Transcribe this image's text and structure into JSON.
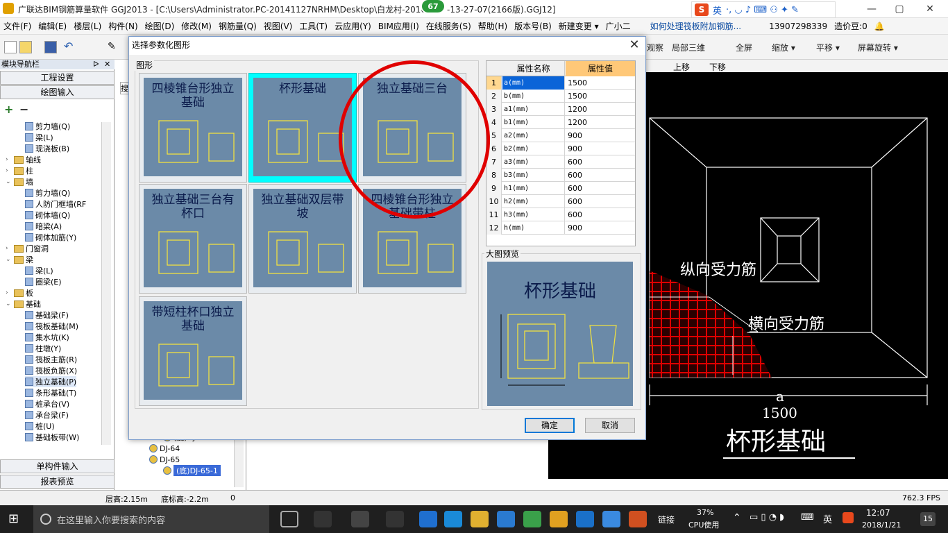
{
  "window": {
    "title": "广联达BIM钢筋算量软件 GGJ2013 - [C:\\Users\\Administrator.PC-20141127NRHM\\Desktop\\白龙村-2016",
    "title_tail": "-13-27-07(2166版).GGJ12]",
    "badge": "67",
    "minimize": "—",
    "maximize": "▢",
    "close": "✕"
  },
  "ime": {
    "logo": "S",
    "lang": "英",
    "icons": "·, ◡ ♪ ⌨ ⚇ ✦ ✎"
  },
  "menu": [
    "文件(F)",
    "编辑(E)",
    "楼层(L)",
    "构件(N)",
    "绘图(D)",
    "修改(M)",
    "钢筋量(Q)",
    "视图(V)",
    "工具(T)",
    "云应用(Y)",
    "BIM应用(I)",
    "在线服务(S)",
    "帮助(H)",
    "版本号(B)",
    "新建变更 ▾",
    "广小二"
  ],
  "menu_extra": {
    "link": "如何处理筏板附加钢筋...",
    "phone": "13907298339",
    "price": "造价豆:0",
    "bell": "🔔"
  },
  "toolbar": {
    "right_items": [
      "观察",
      "局部三维",
      "全屏",
      "缩放 ▾",
      "平移 ▾",
      "屏幕旋转 ▾"
    ],
    "cad_items": [
      "上移",
      "下移"
    ]
  },
  "sidebar": {
    "header": "模块导航栏",
    "pin": "ᐅ",
    "close": "✕",
    "btn_project": "工程设置",
    "btn_draw": "绘图输入",
    "plus": "+",
    "minus": "−",
    "tree": [
      {
        "label": "剪力墙(Q)",
        "indent": 36,
        "kind": "leaf"
      },
      {
        "label": "梁(L)",
        "indent": 36,
        "kind": "leaf"
      },
      {
        "label": "现浇板(B)",
        "indent": 36,
        "kind": "leaf"
      },
      {
        "label": "轴线",
        "indent": 8,
        "kind": "folder",
        "exp": "›"
      },
      {
        "label": "柱",
        "indent": 8,
        "kind": "folder",
        "exp": "›"
      },
      {
        "label": "墙",
        "indent": 8,
        "kind": "folder",
        "exp": "⌄"
      },
      {
        "label": "剪力墙(Q)",
        "indent": 36,
        "kind": "leaf"
      },
      {
        "label": "人防门框墙(RF",
        "indent": 36,
        "kind": "leaf"
      },
      {
        "label": "砌体墙(Q)",
        "indent": 36,
        "kind": "leaf"
      },
      {
        "label": "暗梁(A)",
        "indent": 36,
        "kind": "leaf"
      },
      {
        "label": "砌体加筋(Y)",
        "indent": 36,
        "kind": "leaf"
      },
      {
        "label": "门窗洞",
        "indent": 8,
        "kind": "folder",
        "exp": "›"
      },
      {
        "label": "梁",
        "indent": 8,
        "kind": "folder",
        "exp": "⌄"
      },
      {
        "label": "梁(L)",
        "indent": 36,
        "kind": "leaf"
      },
      {
        "label": "圈梁(E)",
        "indent": 36,
        "kind": "leaf"
      },
      {
        "label": "板",
        "indent": 8,
        "kind": "folder",
        "exp": "›"
      },
      {
        "label": "基础",
        "indent": 8,
        "kind": "folder",
        "exp": "⌄"
      },
      {
        "label": "基础梁(F)",
        "indent": 36,
        "kind": "leaf"
      },
      {
        "label": "筏板基础(M)",
        "indent": 36,
        "kind": "leaf"
      },
      {
        "label": "集水坑(K)",
        "indent": 36,
        "kind": "leaf"
      },
      {
        "label": "柱墩(Y)",
        "indent": 36,
        "kind": "leaf"
      },
      {
        "label": "筏板主筋(R)",
        "indent": 36,
        "kind": "leaf"
      },
      {
        "label": "筏板负筋(X)",
        "indent": 36,
        "kind": "leaf"
      },
      {
        "label": "独立基础(P)",
        "indent": 36,
        "kind": "leaf"
      },
      {
        "label": "条形基础(T)",
        "indent": 36,
        "kind": "leaf"
      },
      {
        "label": "桩承台(V)",
        "indent": 36,
        "kind": "leaf"
      },
      {
        "label": "承台梁(F)",
        "indent": 36,
        "kind": "leaf"
      },
      {
        "label": "桩(U)",
        "indent": 36,
        "kind": "leaf"
      },
      {
        "label": "基础板带(W)",
        "indent": 36,
        "kind": "leaf"
      }
    ],
    "btn_single": "单构件输入",
    "btn_report": "报表预览"
  },
  "midpanel": {
    "tab": "搜",
    "items": [
      {
        "label": "(底)DJ-65-1",
        "indent": 70,
        "selected": false
      },
      {
        "label": "DJ-64",
        "indent": 50,
        "selected": false
      },
      {
        "label": "DJ-65",
        "indent": 50,
        "selected": false
      },
      {
        "label": "(底)DJ-65-1",
        "indent": 70,
        "selected": true
      }
    ]
  },
  "dialog": {
    "title": "选择参数化图形",
    "close": "✕",
    "group_label": "图形",
    "shapes": [
      {
        "label": "四棱锥台形独立基础",
        "selected": false
      },
      {
        "label": "杯形基础",
        "selected": true
      },
      {
        "label": "独立基础三台",
        "selected": false
      },
      {
        "label": "独立基础三台有杯口",
        "selected": false
      },
      {
        "label": "独立基础双层带坡",
        "selected": false
      },
      {
        "label": "四棱锥台形独立基础带柱",
        "selected": false
      },
      {
        "label": "带短柱杯口独立基础",
        "selected": false
      }
    ],
    "table": {
      "col_name": "属性名称",
      "col_value": "属性值",
      "rows": [
        {
          "n": "1",
          "name": "a(mm)",
          "value": "1500"
        },
        {
          "n": "2",
          "name": "b(mm)",
          "value": "1500"
        },
        {
          "n": "3",
          "name": "a1(mm)",
          "value": "1200"
        },
        {
          "n": "4",
          "name": "b1(mm)",
          "value": "1200"
        },
        {
          "n": "5",
          "name": "a2(mm)",
          "value": "900"
        },
        {
          "n": "6",
          "name": "b2(mm)",
          "value": "900"
        },
        {
          "n": "7",
          "name": "a3(mm)",
          "value": "600"
        },
        {
          "n": "8",
          "name": "b3(mm)",
          "value": "600"
        },
        {
          "n": "9",
          "name": "h1(mm)",
          "value": "600"
        },
        {
          "n": "10",
          "name": "h2(mm)",
          "value": "600"
        },
        {
          "n": "11",
          "name": "h3(mm)",
          "value": "600"
        },
        {
          "n": "12",
          "name": "h(mm)",
          "value": "900"
        }
      ]
    },
    "preview_label": "大图预览",
    "preview_title": "杯形基础",
    "ok": "确定",
    "cancel": "取消"
  },
  "canvas": {
    "label_long": "纵向受力筋",
    "label_trans": "横向受力筋",
    "dim_a": "a",
    "dim_value": "1500",
    "title": "杯形基础"
  },
  "status": {
    "floor_h": "层高:2.15m",
    "base_h": "底标高:-2.2m",
    "zero": "0",
    "fps": "762.3 FPS"
  },
  "taskbar": {
    "search": "在这里输入你要搜索的内容",
    "link": "链接",
    "cpu_pct": "37%",
    "cpu_label": "CPU使用",
    "lang": "英",
    "time": "12:07",
    "date": "2018/1/21",
    "notif": "15"
  },
  "colors": {
    "accent": "#0078d7",
    "tile_bg": "#6b8aa8",
    "selected_tile": "#00ffff",
    "annotation": "#e00000",
    "cad_line": "#ffffff",
    "rebar": "#e00000"
  }
}
